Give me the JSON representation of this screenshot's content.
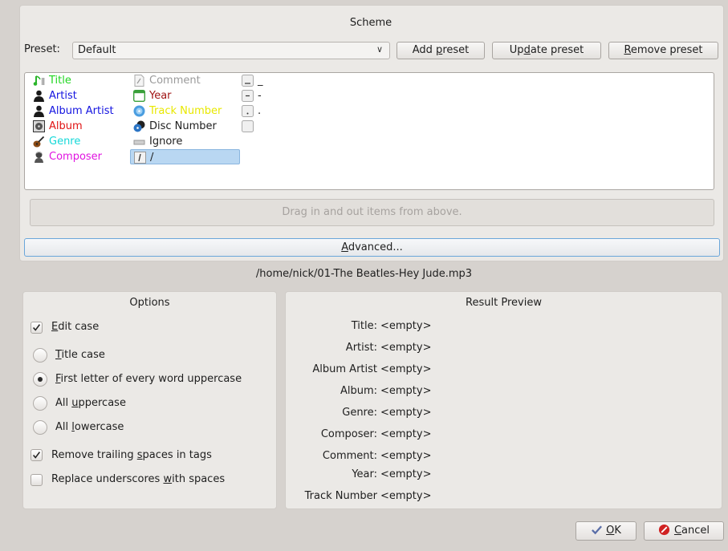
{
  "scheme": {
    "title": "Scheme",
    "preset_label": "Preset:",
    "preset_value": "Default",
    "add_preset": "Add preset",
    "update_preset": "Update preset",
    "remove_preset": "Remove preset",
    "drop_hint": "Drag in and out items from above.",
    "advanced": "Advanced...",
    "tokens_col1": [
      {
        "label": "Title",
        "color": "#1fd61f",
        "icon": "music-note-icon"
      },
      {
        "label": "Artist",
        "color": "#1414e0",
        "icon": "person-icon"
      },
      {
        "label": "Album Artist",
        "color": "#1414e0",
        "icon": "person-icon"
      },
      {
        "label": "Album",
        "color": "#e01414",
        "icon": "cd-case-icon"
      },
      {
        "label": "Genre",
        "color": "#14d8d8",
        "icon": "guitar-icon"
      },
      {
        "label": "Composer",
        "color": "#e014e0",
        "icon": "composer-icon"
      }
    ],
    "tokens_col2": [
      {
        "label": "Comment",
        "color": "#9a9a9a",
        "icon": "comment-icon"
      },
      {
        "label": "Year",
        "color": "#a01414",
        "icon": "calendar-icon"
      },
      {
        "label": "Track Number",
        "color": "#e8e800",
        "icon": "disc-icon"
      },
      {
        "label": "Disc Number",
        "color": "#1e1e1e",
        "icon": "discs-icon"
      },
      {
        "label": "Ignore",
        "color": "#1e1e1e",
        "icon": "ignore-icon"
      },
      {
        "label": "/",
        "color": "#1e1e1e",
        "icon": "separator-icon"
      }
    ],
    "tokens_col3": [
      "_",
      "-",
      ".",
      ""
    ]
  },
  "filename": "/home/nick/01-The Beatles-Hey Jude.mp3",
  "options": {
    "title": "Options",
    "edit_case": "Edit case",
    "title_case": "Title case",
    "first_letter": "First letter of every word uppercase",
    "all_upper": "All uppercase",
    "all_lower": "All lowercase",
    "remove_trailing": "Remove trailing spaces in tags",
    "replace_underscores": "Replace underscores with spaces",
    "edit_case_checked": true,
    "selected_case": "First letter of every word uppercase",
    "remove_trailing_checked": true,
    "replace_underscores_checked": false
  },
  "preview": {
    "title": "Result Preview",
    "rows": [
      {
        "label": "Title:",
        "value": "<empty>"
      },
      {
        "label": "Artist:",
        "value": "<empty>"
      },
      {
        "label": "Album Artist",
        "value": "<empty>"
      },
      {
        "label": "Album:",
        "value": "<empty>"
      },
      {
        "label": "Genre:",
        "value": "<empty>"
      },
      {
        "label": "Composer:",
        "value": "<empty>"
      },
      {
        "label": "Comment:",
        "value": "<empty>"
      },
      {
        "label": "Year:",
        "value": "<empty>"
      },
      {
        "label": "Track Number",
        "value": "<empty>"
      }
    ]
  },
  "buttons": {
    "ok": "OK",
    "cancel": "Cancel"
  }
}
